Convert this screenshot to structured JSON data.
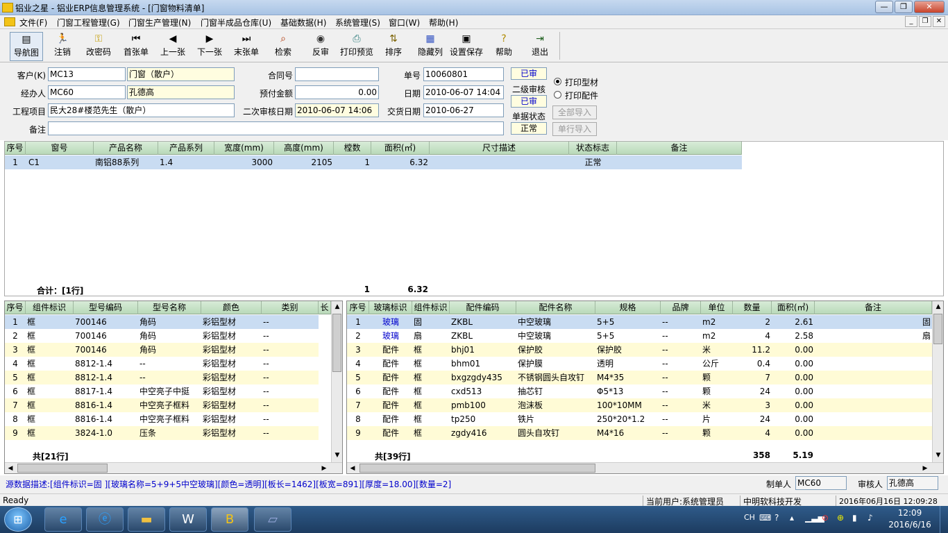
{
  "window": {
    "title": "铝业之星 - 铝业ERP信息管理系统 - [门窗物料清单]"
  },
  "menu": [
    "文件(F)",
    "门窗工程管理(G)",
    "门窗生产管理(N)",
    "门窗半成品仓库(U)",
    "基础数据(H)",
    "系统管理(S)",
    "窗口(W)",
    "帮助(H)"
  ],
  "toolbar": [
    {
      "label": "导航图",
      "icon": "navigation-map-icon"
    },
    {
      "label": "注销",
      "icon": "logout-icon"
    },
    {
      "label": "改密码",
      "icon": "key-icon"
    },
    {
      "label": "首张单",
      "icon": "first-record-icon"
    },
    {
      "label": "上一张",
      "icon": "previous-record-icon"
    },
    {
      "label": "下一张",
      "icon": "next-record-icon"
    },
    {
      "label": "末张单",
      "icon": "last-record-icon"
    },
    {
      "label": "检索",
      "icon": "search-icon"
    },
    {
      "label": "反审",
      "icon": "unapprove-icon"
    },
    {
      "label": "打印预览",
      "icon": "print-preview-icon"
    },
    {
      "label": "排序",
      "icon": "sort-icon"
    },
    {
      "label": "隐藏列",
      "icon": "hide-columns-icon"
    },
    {
      "label": "设置保存",
      "icon": "save-settings-icon"
    },
    {
      "label": "帮助",
      "icon": "help-icon"
    },
    {
      "label": "退出",
      "icon": "exit-icon"
    }
  ],
  "form": {
    "customer_label": "客户(K)",
    "customer_code": "MC13",
    "customer_name": "门窗（散户）",
    "handler_label": "经办人",
    "handler_code": "MC60",
    "handler_name": "孔德高",
    "project_label": "工程项目",
    "project": "民大28#楼范先生（散户）",
    "remark_label": "备注",
    "remark": "",
    "contract_label": "合同号",
    "contract": "",
    "prepay_label": "预付金额",
    "prepay": "0.00",
    "review2_date_label": "二次审核日期",
    "review2_date": "2010-06-07 14:06",
    "order_no_label": "单号",
    "order_no": "10060801",
    "date_label": "日期",
    "date": "2010-06-07 14:04",
    "delivery_label": "交货日期",
    "delivery": "2010-06-27",
    "status1": "已审",
    "review2_label": "二级审核",
    "status2": "已审",
    "doc_status_label": "单据状态",
    "doc_status": "正常",
    "radio_profile": "打印型材",
    "radio_parts": "打印配件",
    "import_all": "全部导入",
    "import_row": "单行导入"
  },
  "window_grid": {
    "headers": [
      "序号",
      "窗号",
      "产品名称",
      "产品系列",
      "宽度(mm)",
      "高度(mm)",
      "樘数",
      "面积(㎡)",
      "尺寸描述",
      "状态标志",
      "备注"
    ],
    "rows": [
      [
        "1",
        "C1",
        "南铝88系列",
        "1.4",
        "3000",
        "2105",
        "1",
        "6.32",
        "",
        "正常",
        ""
      ]
    ],
    "total_label": "合计：[1行]",
    "total_qty": "1",
    "total_area": "6.32"
  },
  "profile_grid": {
    "headers": [
      "序号",
      "组件标识",
      "型号编码",
      "型号名称",
      "颜色",
      "类别",
      "长"
    ],
    "rows": [
      [
        "1",
        "框",
        "700146",
        "角码",
        "彩铝型材",
        "--"
      ],
      [
        "2",
        "框",
        "700146",
        "角码",
        "彩铝型材",
        "--"
      ],
      [
        "3",
        "框",
        "700146",
        "角码",
        "彩铝型材",
        "--"
      ],
      [
        "4",
        "框",
        "8812-1.4",
        "--",
        "彩铝型材",
        "--"
      ],
      [
        "5",
        "框",
        "8812-1.4",
        "--",
        "彩铝型材",
        "--"
      ],
      [
        "6",
        "框",
        "8817-1.4",
        "中空亮子中挺",
        "彩铝型材",
        "--"
      ],
      [
        "7",
        "框",
        "8816-1.4",
        "中空亮子框料",
        "彩铝型材",
        "--"
      ],
      [
        "8",
        "框",
        "8816-1.4",
        "中空亮子框料",
        "彩铝型材",
        "--"
      ],
      [
        "9",
        "框",
        "3824-1.0",
        "压条",
        "彩铝型材",
        "--"
      ]
    ],
    "total_label": "共[21行]"
  },
  "parts_grid": {
    "headers": [
      "序号",
      "玻璃标识",
      "组件标识",
      "配件编码",
      "配件名称",
      "规格",
      "品牌",
      "单位",
      "数量",
      "面积(㎡)",
      "备注"
    ],
    "rows": [
      [
        "1",
        "玻璃",
        "固",
        "ZKBL",
        "中空玻璃",
        "5+5",
        "--",
        "m2",
        "2",
        "2.61",
        "固"
      ],
      [
        "2",
        "玻璃",
        "扇",
        "ZKBL",
        "中空玻璃",
        "5+5",
        "--",
        "m2",
        "4",
        "2.58",
        "扇"
      ],
      [
        "3",
        "配件",
        "框",
        "bhj01",
        "保护胶",
        "保护胶",
        "--",
        "米",
        "11.2",
        "0.00",
        ""
      ],
      [
        "4",
        "配件",
        "框",
        "bhm01",
        "保护膜",
        "透明",
        "--",
        "公斤",
        "0.4",
        "0.00",
        ""
      ],
      [
        "5",
        "配件",
        "框",
        "bxgzgdy435",
        "不锈钢圆头自攻钉",
        "M4*35",
        "--",
        "颗",
        "7",
        "0.00",
        ""
      ],
      [
        "6",
        "配件",
        "框",
        "cxd513",
        "抽芯钉",
        "Φ5*13",
        "--",
        "颗",
        "24",
        "0.00",
        ""
      ],
      [
        "7",
        "配件",
        "框",
        "pmb100",
        "泡沫板",
        "100*10MM",
        "--",
        "米",
        "3",
        "0.00",
        ""
      ],
      [
        "8",
        "配件",
        "框",
        "tp250",
        "铁片",
        "250*20*1.2",
        "--",
        "片",
        "24",
        "0.00",
        ""
      ],
      [
        "9",
        "配件",
        "框",
        "zgdy416",
        "圆头自攻钉",
        "M4*16",
        "--",
        "颗",
        "4",
        "0.00",
        ""
      ]
    ],
    "total_label": "共[39行]",
    "total_qty": "358",
    "total_area": "5.19"
  },
  "bottom": {
    "source_desc": "源数据描述:[组件标识=固 ][玻璃名称=5+9+5中空玻璃][颜色=透明][板长=1462][板宽=891][厚度=18.00][数量=2]",
    "maker_label": "制单人",
    "maker": "MC60",
    "reviewer_label": "审核人",
    "reviewer": "孔德高"
  },
  "status": {
    "ready": "Ready",
    "user": "当前用户:系统管理员",
    "company": "中明软科技开发",
    "datetime": "2016年06月16日 12:09:28"
  },
  "taskbar": {
    "lang": "CH",
    "time": "12:09",
    "date": "2016/6/16"
  },
  "colors": {
    "header_green": "#c8e3c8",
    "row_selected": "#c9dcf2",
    "row_alt": "#fffbd6",
    "status_blue": "#0000cc"
  }
}
